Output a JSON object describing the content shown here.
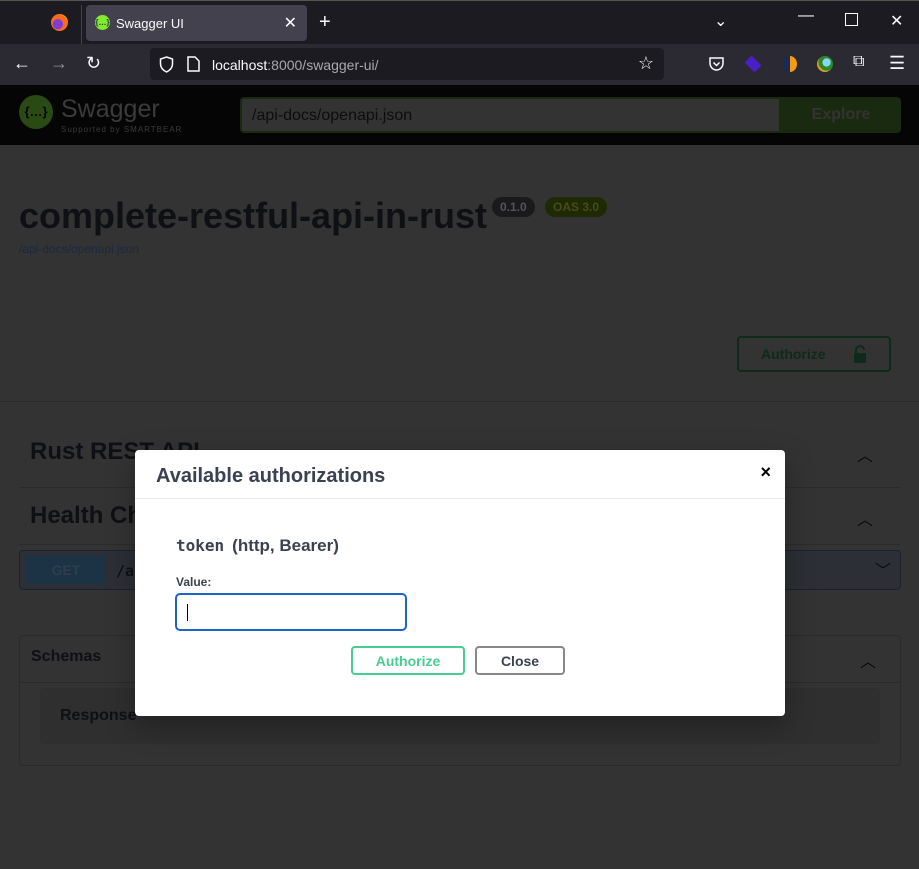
{
  "browser": {
    "tab_title": "Swagger UI",
    "favicon_glyph": "{…}",
    "url_host": "localhost",
    "url_rest": ":8000/swagger-ui/",
    "icons": [
      "firefox-logo",
      "tab-close",
      "new-tab",
      "list-all-tabs",
      "minimize",
      "maximize",
      "close-window",
      "back",
      "forward",
      "reload",
      "shield",
      "page",
      "bookmark-star",
      "pocket",
      "extension-purple",
      "extension-orange",
      "extension-idm",
      "extensions",
      "menu"
    ]
  },
  "swagger": {
    "brand": "Swagger",
    "brand_sub": "Supported by SMARTBEAR",
    "spec_url": "/api-docs/openapi.json",
    "explore_label": "Explore",
    "title": "complete-restful-api-in-rust",
    "version": "0.1.0",
    "oas": "OAS 3.0",
    "spec_link": "/api-docs/openapi.json",
    "authorize_label": "Authorize",
    "tags": [
      {
        "name": "Rust REST API"
      },
      {
        "name": "Health Checker API"
      }
    ],
    "operation": {
      "method": "GET",
      "path": "/api/healthchecker"
    },
    "schemas_label": "Schemas",
    "schema_items": [
      {
        "name": "Response"
      }
    ]
  },
  "modal": {
    "title": "Available authorizations",
    "close_glyph": "×",
    "scheme_name": "token",
    "scheme_type": "(http, Bearer)",
    "value_label": "Value:",
    "value": "",
    "authorize_label": "Authorize",
    "close_label": "Close"
  },
  "colors": {
    "accent_green": "#49cc90",
    "focus_blue": "#1c64c9",
    "text": "#3b4151",
    "overlay_bg": "#333333"
  }
}
